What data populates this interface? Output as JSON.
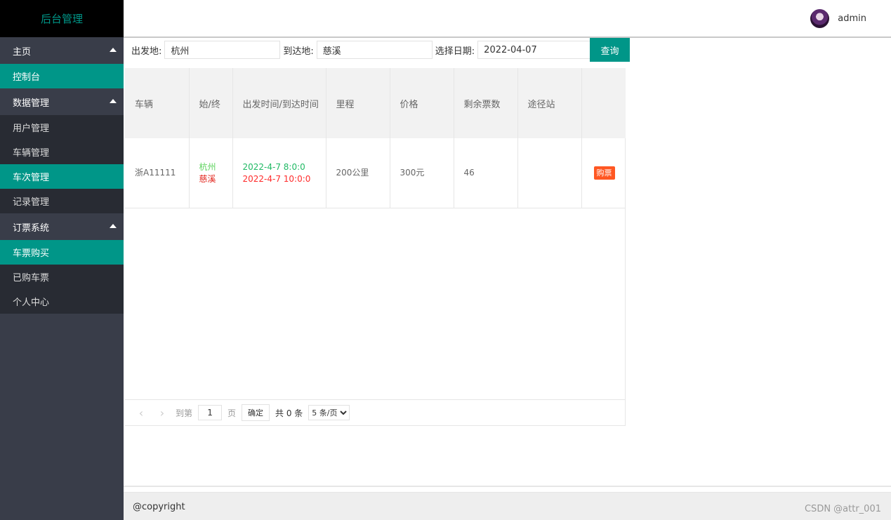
{
  "header": {
    "logo": "后台管理",
    "username": "admin"
  },
  "sidebar": {
    "groups": [
      {
        "label": "主页",
        "items": [
          {
            "label": "控制台"
          }
        ]
      },
      {
        "label": "数据管理",
        "items": [
          {
            "label": "用户管理"
          },
          {
            "label": "车辆管理"
          },
          {
            "label": "车次管理"
          },
          {
            "label": "记录管理"
          }
        ]
      },
      {
        "label": "订票系统",
        "items": [
          {
            "label": "车票购买"
          },
          {
            "label": "已购车票"
          },
          {
            "label": "个人中心"
          }
        ]
      }
    ]
  },
  "search": {
    "from_label": "出发地:",
    "from_value": "杭州",
    "to_label": "到达地:",
    "to_value": "慈溪",
    "date_label": "选择日期:",
    "date_value": "2022-04-07",
    "query_button": "查询"
  },
  "table": {
    "columns": [
      "车辆",
      "始/终",
      "出发时间/到达时间",
      "里程",
      "价格",
      "剩余票数",
      "途径站",
      ""
    ],
    "rows": [
      {
        "vehicle": "浙A11111",
        "start": "杭州",
        "end": "慈溪",
        "depart": "2022-4-7 8:0:0",
        "arrive": "2022-4-7 10:0:0",
        "distance": "200公里",
        "price": "300元",
        "remaining": "46",
        "via": "",
        "action": "购票"
      }
    ]
  },
  "pager": {
    "goto": "到第",
    "page": "1",
    "page_unit": "页",
    "confirm": "确定",
    "total": "共 0 条",
    "per_page": "5 条/页"
  },
  "footer": {
    "copyright": "@copyright",
    "watermark": "CSDN @attr_001"
  },
  "colors": {
    "brand": "#009688",
    "sidebar": "#393d49",
    "buy": "#ff5722"
  }
}
